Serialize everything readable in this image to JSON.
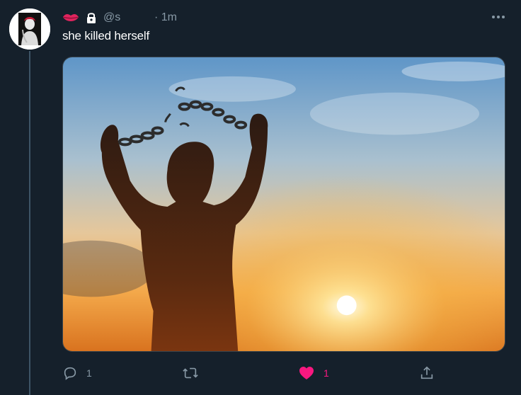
{
  "tweet": {
    "handle": "@s",
    "time": "· 1m",
    "text": "she killed herself",
    "media_icon": "silhouette-breaking-chains-sunset-image"
  },
  "header_icons": [
    "lips-icon",
    "lock-icon"
  ],
  "actions": {
    "reply_count": "1",
    "retweet_count": "",
    "like_count": "1",
    "liked": true
  },
  "colors": {
    "background": "#15202b",
    "text": "#ffffff",
    "muted": "#8899a6",
    "like": "#f91880",
    "lips": "#e0245e"
  }
}
